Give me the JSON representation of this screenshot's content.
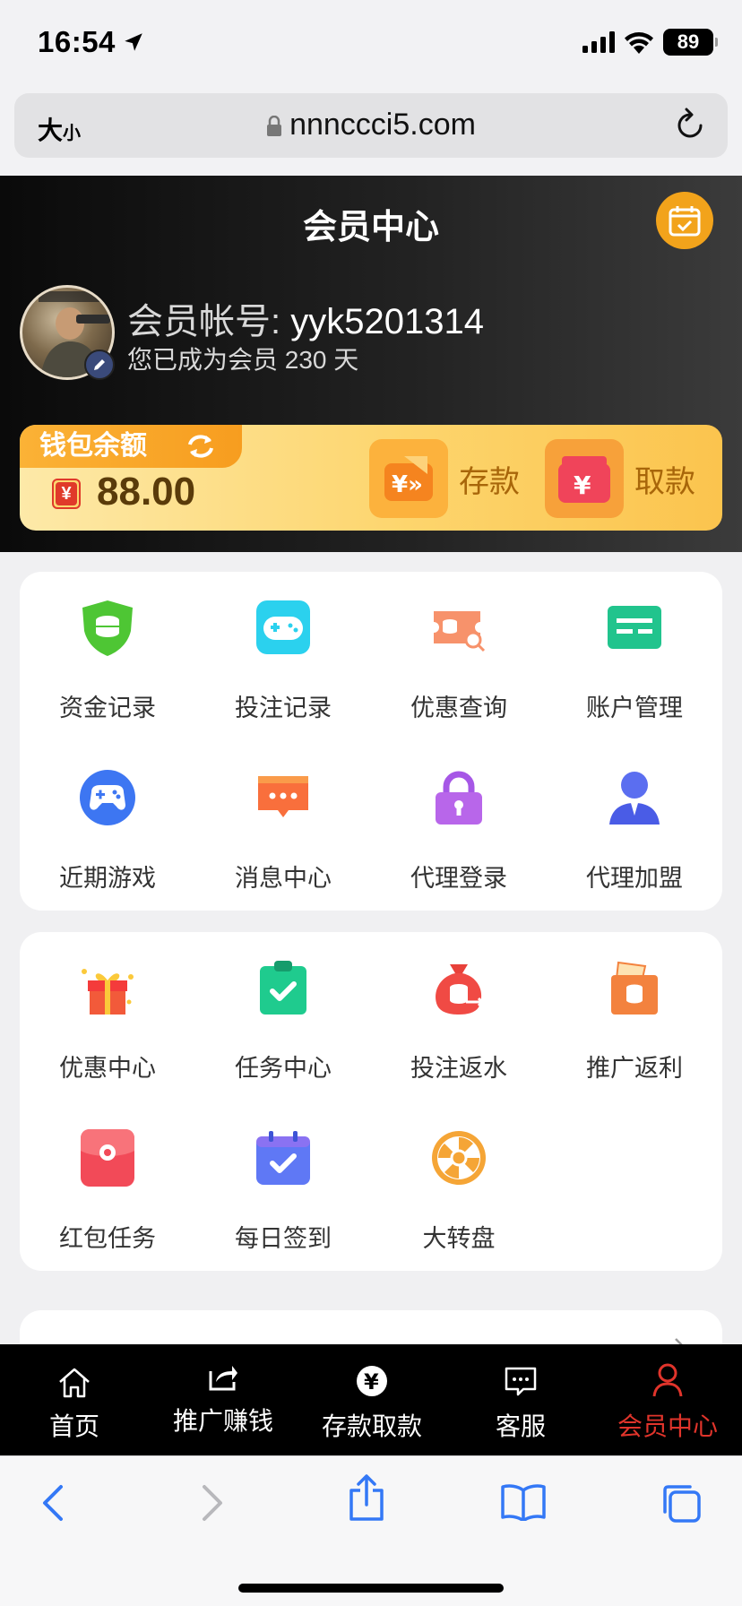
{
  "status_bar": {
    "time": "16:54",
    "battery": "89"
  },
  "url_bar": {
    "text_size_label": "大",
    "text_size_small": "小",
    "url": "nnncccі5.com"
  },
  "header": {
    "title": "会员中心"
  },
  "profile": {
    "account_label": "会员帐号:",
    "account_id": "yyk5201314",
    "member_days_text": "您已成为会员 230 天"
  },
  "wallet": {
    "title": "钱包余额",
    "currency_symbol": "¥",
    "balance": "88.00",
    "deposit_label": "存款",
    "withdraw_label": "取款"
  },
  "menu1": {
    "items": [
      {
        "label": "资金记录",
        "icon": "shield-coins-icon"
      },
      {
        "label": "投注记录",
        "icon": "gamepad-icon"
      },
      {
        "label": "优惠查询",
        "icon": "ticket-search-icon"
      },
      {
        "label": "账户管理",
        "icon": "card-icon"
      },
      {
        "label": "近期游戏",
        "icon": "controller-icon"
      },
      {
        "label": "消息中心",
        "icon": "message-icon"
      },
      {
        "label": "代理登录",
        "icon": "lock-icon"
      },
      {
        "label": "代理加盟",
        "icon": "agent-icon"
      }
    ]
  },
  "menu2": {
    "items": [
      {
        "label": "优惠中心",
        "icon": "gift-icon"
      },
      {
        "label": "任务中心",
        "icon": "clipboard-check-icon"
      },
      {
        "label": "投注返水",
        "icon": "money-bag-icon"
      },
      {
        "label": "推广返利",
        "icon": "envelope-coins-icon"
      },
      {
        "label": "红包任务",
        "icon": "red-packet-icon"
      },
      {
        "label": "每日签到",
        "icon": "calendar-check-icon"
      },
      {
        "label": "大转盘",
        "icon": "wheel-icon"
      }
    ]
  },
  "tabbar": {
    "items": [
      {
        "label": "首页",
        "icon": "home-icon"
      },
      {
        "label": "推广赚钱",
        "icon": "share-icon"
      },
      {
        "label": "存款取款",
        "icon": "yen-coin-icon"
      },
      {
        "label": "客服",
        "icon": "chat-icon"
      },
      {
        "label": "会员中心",
        "icon": "user-icon",
        "active": true
      }
    ]
  },
  "colors": {
    "accent": "#e0342b",
    "wallet_gold": "#fbc44e",
    "ios_blue": "#3478f6"
  }
}
